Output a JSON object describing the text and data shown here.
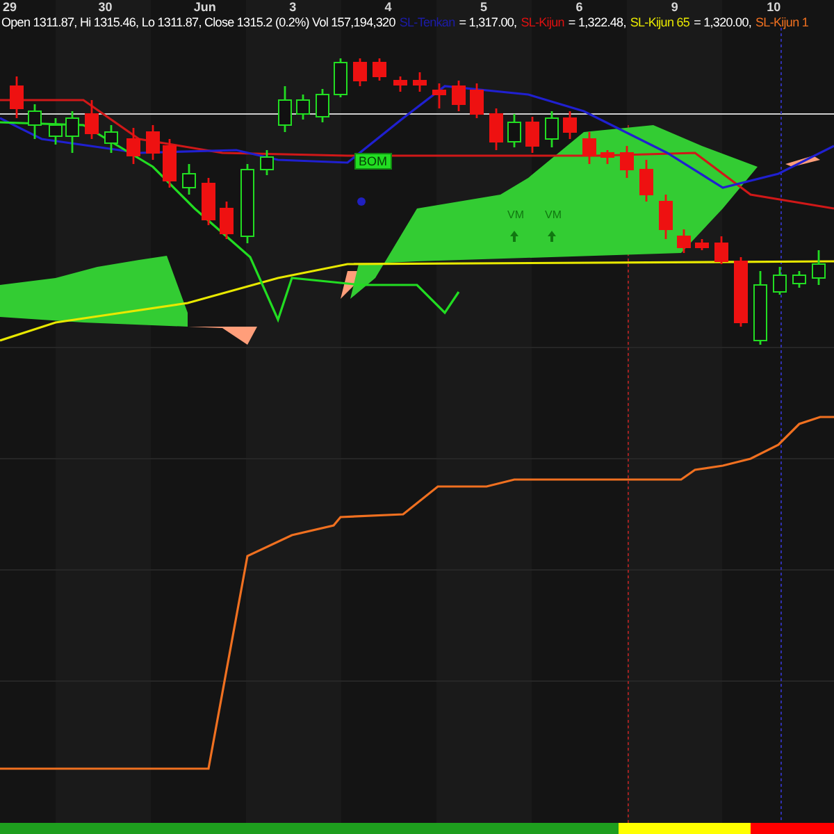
{
  "axis": {
    "dates": [
      {
        "label": "29"
      },
      {
        "label": "30"
      },
      {
        "label": "Jun"
      },
      {
        "label": "3"
      },
      {
        "label": "4"
      },
      {
        "label": "5"
      },
      {
        "label": "6"
      },
      {
        "label": "9"
      },
      {
        "label": "10"
      }
    ]
  },
  "legend": [
    {
      "text": "Open 1311.87, Hi 1315.46, Lo 1311.87, Close 1315.2 (0.2%) Vol 157,194,320",
      "color": "#ffffff"
    },
    {
      "text": "SL-Tenkan",
      "color": "#1c1ca8"
    },
    {
      "text": "= 1,317.00,",
      "color": "#ffffff"
    },
    {
      "text": "SL-Kijun",
      "color": "#e01010"
    },
    {
      "text": "= 1,322.48,",
      "color": "#ffffff"
    },
    {
      "text": "SL-Kijun 65",
      "color": "#e8e800"
    },
    {
      "text": "= 1,320.00,",
      "color": "#ffffff"
    },
    {
      "text": "SL-Kijun 1",
      "color": "#f07020"
    }
  ],
  "signals": [
    {
      "label": "BOM",
      "kind": "box"
    },
    {
      "label": "VM",
      "kind": "arrow"
    },
    {
      "label": "VM",
      "kind": "arrow"
    }
  ],
  "status_bar": [
    {
      "color": "#1e9e1e"
    },
    {
      "color": "#ffff00"
    },
    {
      "color": "#ff0000"
    }
  ]
}
